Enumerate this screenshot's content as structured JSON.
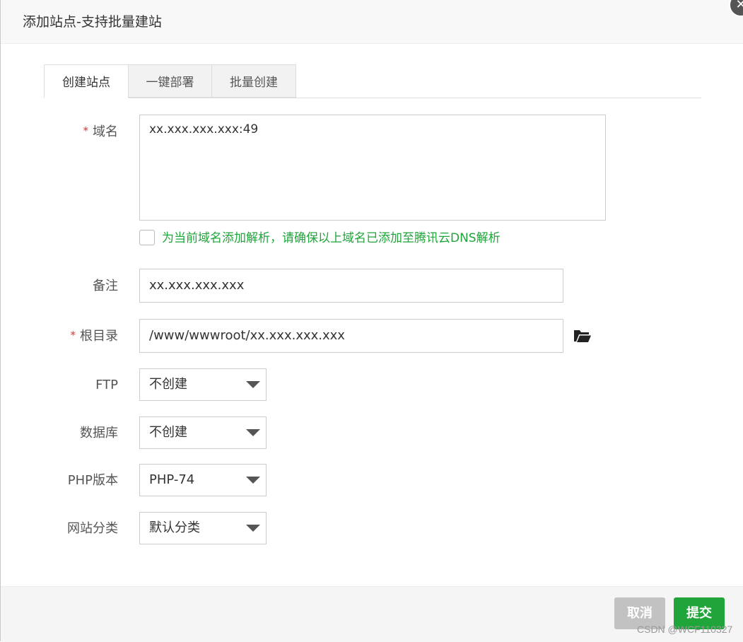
{
  "dialog": {
    "title": "添加站点-支持批量建站",
    "close_glyph": "✕"
  },
  "tabs": [
    {
      "label": "创建站点",
      "active": true
    },
    {
      "label": "一键部署",
      "active": false
    },
    {
      "label": "批量创建",
      "active": false
    }
  ],
  "form": {
    "domain": {
      "required_mark": "*",
      "label": "域名",
      "value": "xx.xxx.xxx.xxx:49"
    },
    "dns_hint": "为当前域名添加解析，请确保以上域名已添加至腾讯云DNS解析",
    "remark": {
      "label": "备注",
      "value": "xx.xxx.xxx.xxx"
    },
    "root_dir": {
      "required_mark": "*",
      "label": "根目录",
      "value": "/www/wwwroot/xx.xxx.xxx.xxx"
    },
    "ftp": {
      "label": "FTP",
      "value": "不创建"
    },
    "database": {
      "label": "数据库",
      "value": "不创建"
    },
    "php_version": {
      "label": "PHP版本",
      "value": "PHP-74"
    },
    "site_category": {
      "label": "网站分类",
      "value": "默认分类"
    }
  },
  "footer": {
    "cancel_label": "取消",
    "submit_label": "提交"
  },
  "watermark": "CSDN @WCF110327",
  "colors": {
    "accent_green": "#20a53a",
    "required_red": "#e03030",
    "cancel_gray": "#c2c2c2"
  },
  "icons": {
    "close": "close-icon",
    "folder": "folder-open-icon",
    "dropdown": "caret-down-icon"
  }
}
